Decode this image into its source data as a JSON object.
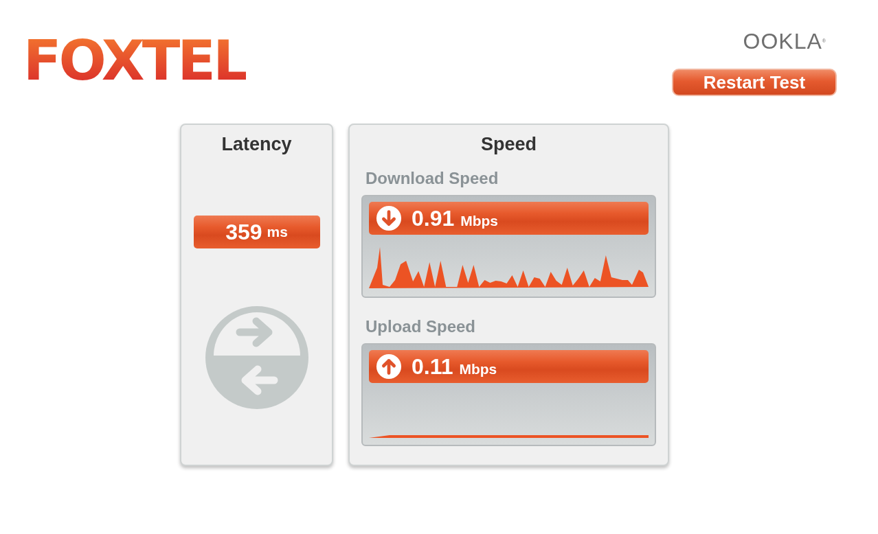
{
  "brand": {
    "logo": "FOXTEL",
    "partner": "OOKLA",
    "partner_mark": "®"
  },
  "restart_button": {
    "label": "Restart Test"
  },
  "latency": {
    "title": "Latency",
    "value": "359",
    "unit": "ms"
  },
  "speed": {
    "title": "Speed",
    "tests": [
      {
        "label": "Download Speed",
        "kind": "download",
        "value": "0.91",
        "unit": "Mbps"
      },
      {
        "label": "Upload Speed",
        "kind": "upload",
        "value": "0.11",
        "unit": "Mbps"
      }
    ]
  }
}
